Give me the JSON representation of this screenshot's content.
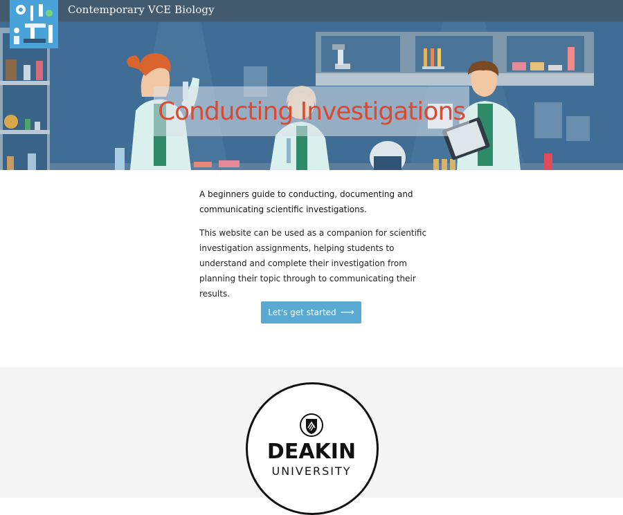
{
  "header": {
    "site_title": "Contemporary VCE Biology",
    "logo_icon": "microscope-lab-icon"
  },
  "hero": {
    "title": "Conducting Investigations",
    "illustration": "lab-scientists-illustration",
    "title_color": "#d94a33"
  },
  "intro": {
    "lead": "A beginners guide to conducting, documenting and communicating scientific investigations.",
    "body": "This website can be used as a companion for scientific investigation assignments, helping students to understand and complete their investigation from planning their topic through to communicating their results.",
    "cta_label": "Let's get started",
    "cta_icon": "arrow-right-icon",
    "cta_color": "#5aa9d2"
  },
  "footer": {
    "logo_name": "DEAKIN",
    "logo_sub": "UNIVERSITY"
  }
}
